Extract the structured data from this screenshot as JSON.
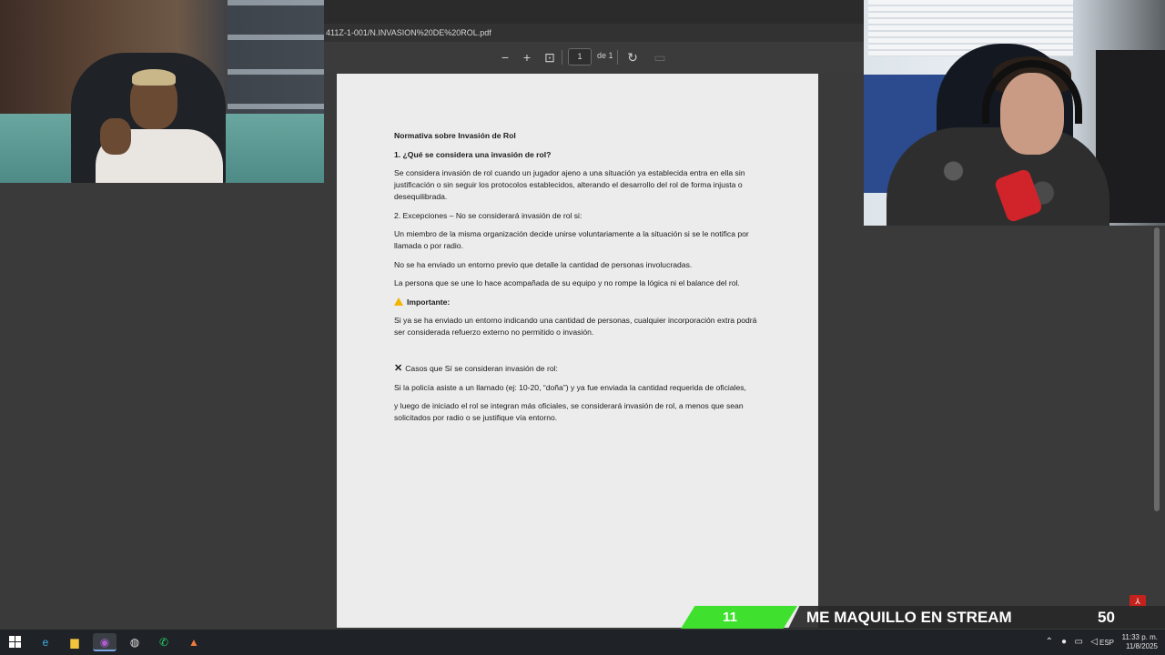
{
  "browser": {
    "url_fragment": "411Z-1-001/N.INVASION%20DE%20ROL.pdf"
  },
  "pdf_toolbar": {
    "zoom_out_glyph": "−",
    "zoom_in_glyph": "+",
    "fit_glyph": "⊡",
    "page_number": "1",
    "page_total": "de 1",
    "rotate_glyph": "↻",
    "doc_glyph": "▭"
  },
  "document": {
    "title": "Normativa sobre Invasión de Rol",
    "section1_heading": "1. ¿Qué se considera una invasión de rol?",
    "section1_body": " Se considera invasión de rol cuando un jugador ajeno a una situación ya establecida entra en ella sin justificación o sin seguir los protocolos establecidos, alterando el desarrollo del rol de forma injusta o desequilibrada.",
    "section2_heading": "2. Excepciones – No se considerará invasión de rol si:",
    "exception1": "Un miembro de la misma organización decide unirse voluntariamente a la situación  si se le notifica por llamada o por radio.",
    "exception2": "No se ha enviado un entorno previo que detalle la cantidad de personas involucradas.",
    "exception3": "La persona que se une lo hace acompañada de su equipo y no rompe la lógica ni el balance del rol.",
    "important_label": "Importante:",
    "important_body": " Si ya se ha enviado un entorno indicando una cantidad de personas, cualquier incorporación extra podrá ser considerada refuerzo externo no permitido o invasión.",
    "cases_heading": "Casos que Sí se consideran invasión de rol:",
    "case_line1": "Si la policía asiste a un llamado (ej: 10-20, “doña”) y ya fue enviada la cantidad requerida de oficiales,",
    "case_line2": " y luego de iniciado el rol se integran más oficiales, se considerará invasión de rol, a menos que sean solicitados por radio o se justifique vía entorno."
  },
  "overlay": {
    "count": "11",
    "title": "ME MAQUILLO EN STREAM",
    "goal": "50",
    "green": "#3fe12e"
  },
  "taskbar": {
    "apps": [
      {
        "name": "edge-icon",
        "glyph": "e"
      },
      {
        "name": "file-explorer-icon",
        "glyph": "▆"
      },
      {
        "name": "chrome-icon",
        "glyph": "◉"
      },
      {
        "name": "obs-icon",
        "glyph": "◍"
      },
      {
        "name": "whatsapp-icon",
        "glyph": "✆"
      },
      {
        "name": "game-app-icon",
        "glyph": "▲"
      }
    ],
    "language": "ESP",
    "time": "11:33 p. m.",
    "date": "11/8/2025"
  },
  "acrobat_glyph": "⅄"
}
